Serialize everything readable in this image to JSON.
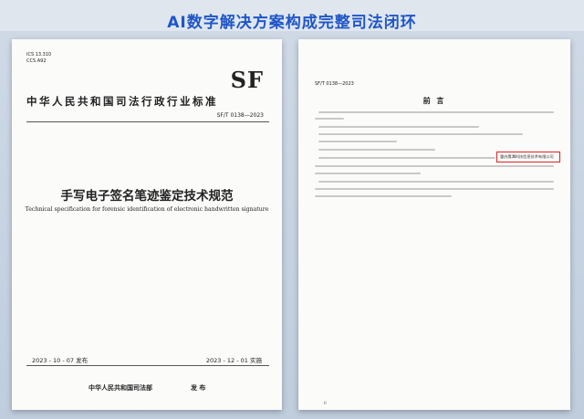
{
  "banner": {
    "title": "AI数字解决方案构成完整司法闭环"
  },
  "cover": {
    "ics": "ICS 13.310",
    "ccs": "CCS A92",
    "sf_logo": "SF",
    "standard_title": "中华人民共和国司法行政行业标准",
    "std_no": "SF/T 0138—2023",
    "title_cn": "手写电子签名笔迹鉴定技术规范",
    "title_en": "Technical specification for forensic identification of electronic handwritten signature",
    "publish_date": "2023 - 10 - 07 发布",
    "implement_date": "2023 - 12 - 01 实施",
    "issuer": "中华人民共和国司法部",
    "issue_label": "发 布"
  },
  "preface": {
    "std_no": "SF/T 0138—2023",
    "heading": "前 言",
    "highlighted_org": "重庆鹰潭科技信息技术有限公司",
    "page_no": "II"
  },
  "colors": {
    "banner": "#1f56c8",
    "highlight": "#e02020"
  }
}
